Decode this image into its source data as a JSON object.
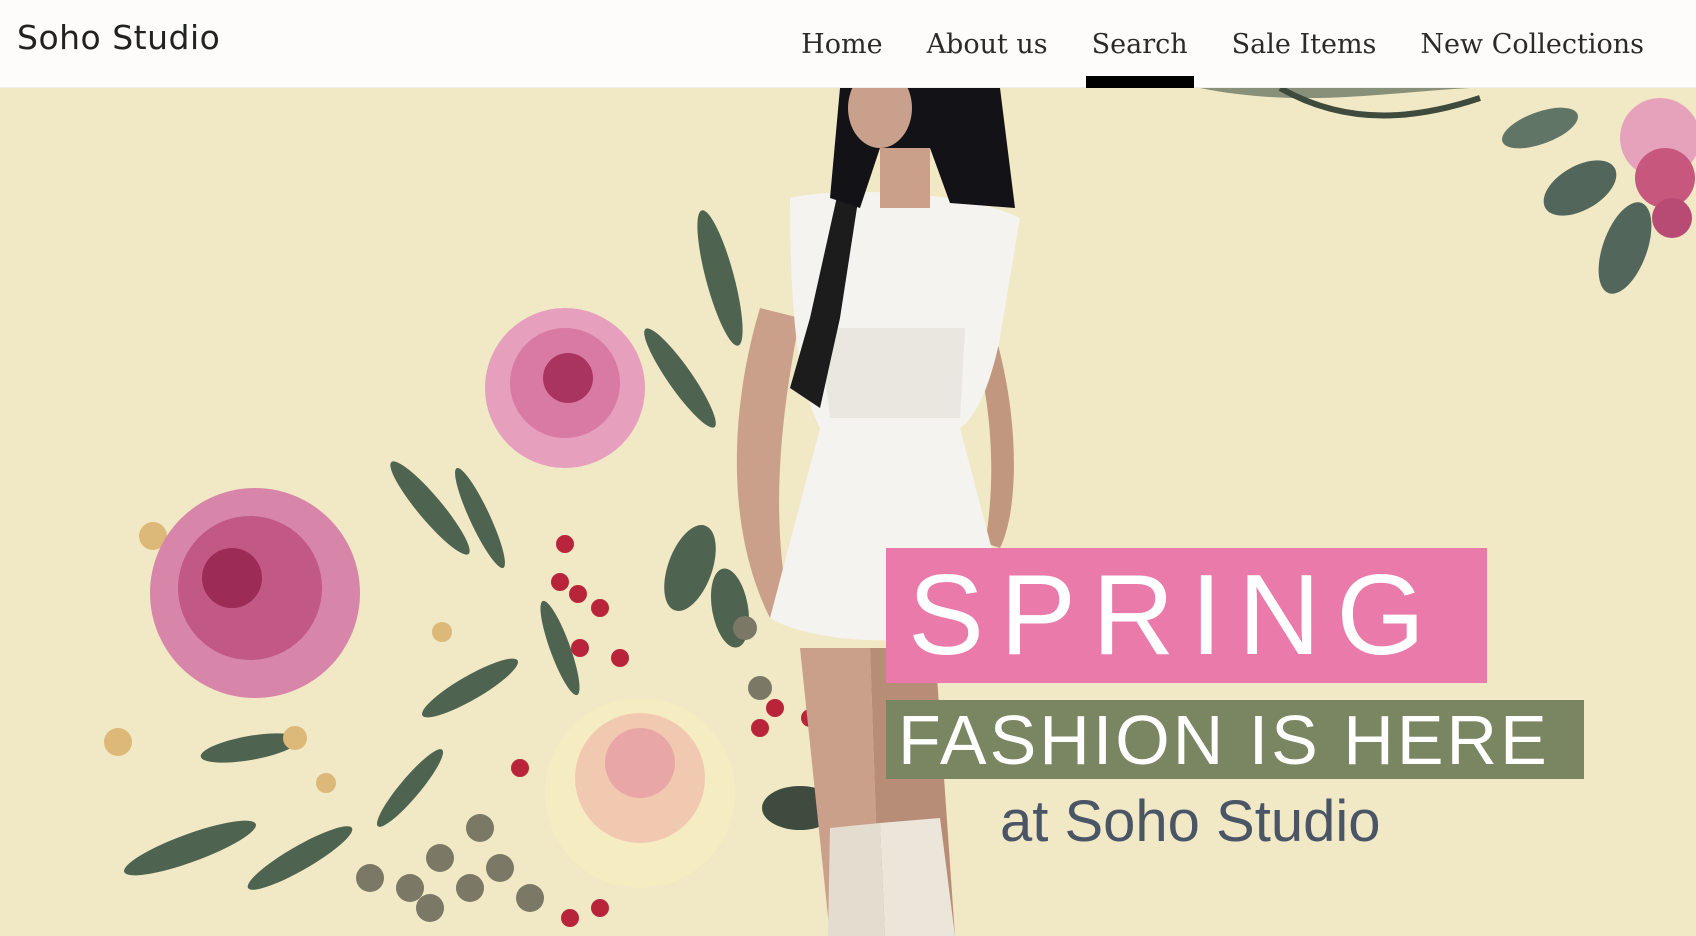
{
  "brand": {
    "name": "Soho Studio"
  },
  "nav": {
    "items": [
      {
        "label": "Home",
        "active": false
      },
      {
        "label": "About us",
        "active": false
      },
      {
        "label": "Search",
        "active": true
      },
      {
        "label": "Sale Items",
        "active": false
      },
      {
        "label": "New Collections",
        "active": false
      }
    ]
  },
  "hero": {
    "line1": "SPRING",
    "line2": "FASHION IS HERE",
    "line3": "at Soho Studio",
    "colors": {
      "background": "#f1e8c6",
      "pink_block": "#ea7aaa",
      "green_block": "#7a8662",
      "subtitle_text": "#4a5566"
    },
    "imagery": [
      "model-in-white-dress",
      "watercolor-floral-bouquet",
      "floral-corner-top-right"
    ]
  }
}
